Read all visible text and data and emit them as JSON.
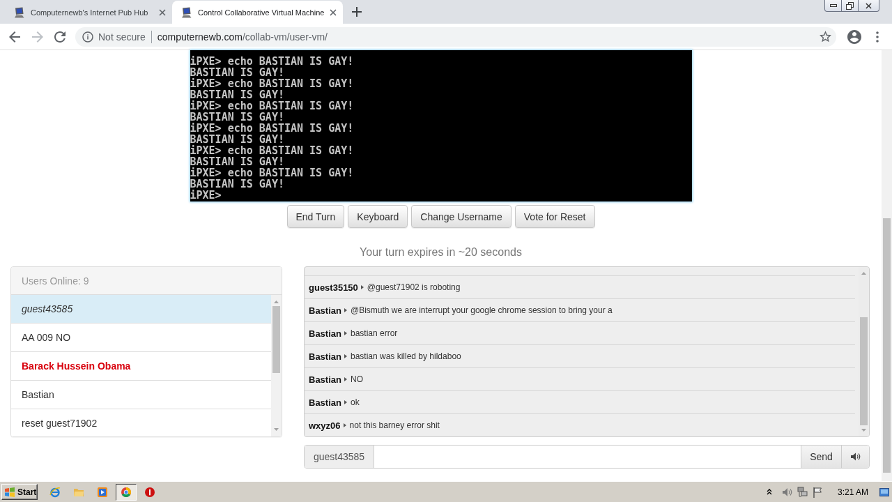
{
  "browser": {
    "tabs": [
      {
        "title": "Computernewb's Internet Pub Hub",
        "selected": false
      },
      {
        "title": "Control Collaborative Virtual Machine",
        "selected": true
      }
    ],
    "navigation": {
      "back_disabled": false,
      "forward_disabled": true
    },
    "address": {
      "security": "Not secure",
      "host": "computernewb.com",
      "path": "/collab-vm/user-vm/"
    }
  },
  "terminal": {
    "lines": [
      "iPXE> echo BASTIAN IS GAY!",
      "BASTIAN IS GAY!",
      "iPXE> echo BASTIAN IS GAY!",
      "BASTIAN IS GAY!",
      "iPXE> echo BASTIAN IS GAY!",
      "BASTIAN IS GAY!",
      "iPXE> echo BASTIAN IS GAY!",
      "BASTIAN IS GAY!",
      "iPXE> echo BASTIAN IS GAY!",
      "BASTIAN IS GAY!",
      "iPXE> echo BASTIAN IS GAY!",
      "BASTIAN IS GAY!",
      "iPXE>"
    ]
  },
  "vm_buttons": [
    "End Turn",
    "Keyboard",
    "Change Username",
    "Vote for Reset"
  ],
  "turn_notice": "Your turn expires in ~20 seconds",
  "users_panel": {
    "title": "Users Online: 9",
    "users": [
      {
        "name": "guest43585",
        "kind": "self",
        "selected": true
      },
      {
        "name": "AA 009 NO",
        "kind": "user",
        "selected": false
      },
      {
        "name": "Barack Hussein Obama",
        "kind": "admin",
        "selected": false
      },
      {
        "name": "Bastian",
        "kind": "user",
        "selected": false
      },
      {
        "name": "reset guest71902",
        "kind": "user",
        "selected": false
      }
    ]
  },
  "chat": {
    "messages": [
      {
        "user": "guest35150",
        "text": "@guest71902 is roboting"
      },
      {
        "user": "Bastian",
        "text": "@Bismuth we are interrupt your google chrome session to bring your a"
      },
      {
        "user": "Bastian",
        "text": "bastian error"
      },
      {
        "user": "Bastian",
        "text": "bastian was killed by hildaboo"
      },
      {
        "user": "Bastian",
        "text": "NO"
      },
      {
        "user": "Bastian",
        "text": "ok"
      },
      {
        "user": "wxyz06",
        "text": "not this barney error shit"
      }
    ],
    "input": {
      "username": "guest43585",
      "send": "Send"
    }
  },
  "taskbar": {
    "start": "Start",
    "apps": [
      {
        "kind": "ie",
        "selected": false
      },
      {
        "kind": "folder",
        "selected": false
      },
      {
        "kind": "media",
        "selected": false
      },
      {
        "kind": "chrome",
        "selected": true
      },
      {
        "kind": "stop",
        "selected": false
      }
    ],
    "clock": "3:21 AM"
  }
}
